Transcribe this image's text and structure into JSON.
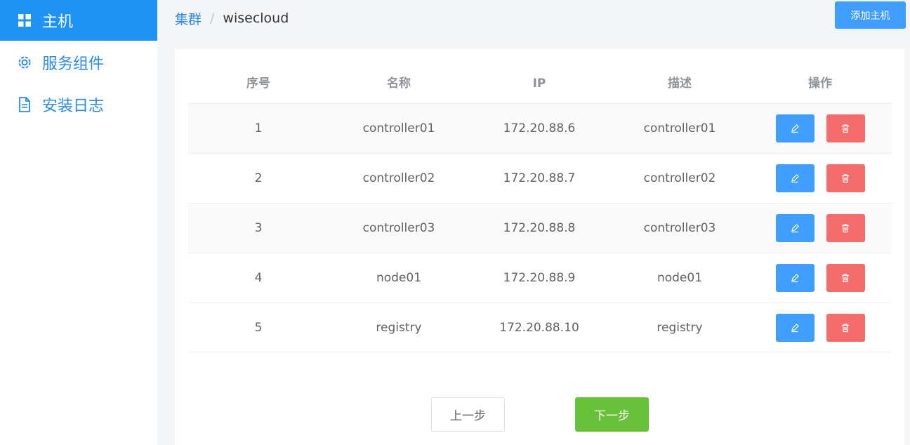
{
  "sidebar": {
    "items": [
      {
        "label": "主机",
        "icon": "grid-icon",
        "active": true
      },
      {
        "label": "服务组件",
        "icon": "gear-icon",
        "active": false
      },
      {
        "label": "安装日志",
        "icon": "document-icon",
        "active": false
      }
    ]
  },
  "breadcrumb": {
    "parent": "集群",
    "separator": "/",
    "current": "wisecloud"
  },
  "header": {
    "add_host_label": "添加主机"
  },
  "table": {
    "columns": [
      "序号",
      "名称",
      "IP",
      "描述",
      "操作"
    ],
    "rows": [
      {
        "index": "1",
        "name": "controller01",
        "ip": "172.20.88.6",
        "desc": "controller01"
      },
      {
        "index": "2",
        "name": "controller02",
        "ip": "172.20.88.7",
        "desc": "controller02"
      },
      {
        "index": "3",
        "name": "controller03",
        "ip": "172.20.88.8",
        "desc": "controller03"
      },
      {
        "index": "4",
        "name": "node01",
        "ip": "172.20.88.9",
        "desc": "node01"
      },
      {
        "index": "5",
        "name": "registry",
        "ip": "172.20.88.10",
        "desc": "registry"
      }
    ]
  },
  "footer": {
    "prev_label": "上一步",
    "next_label": "下一步"
  },
  "colors": {
    "primary": "#409eff",
    "danger": "#f56c6c",
    "success": "#67c23a",
    "sidebar_active": "#1f93f5"
  }
}
